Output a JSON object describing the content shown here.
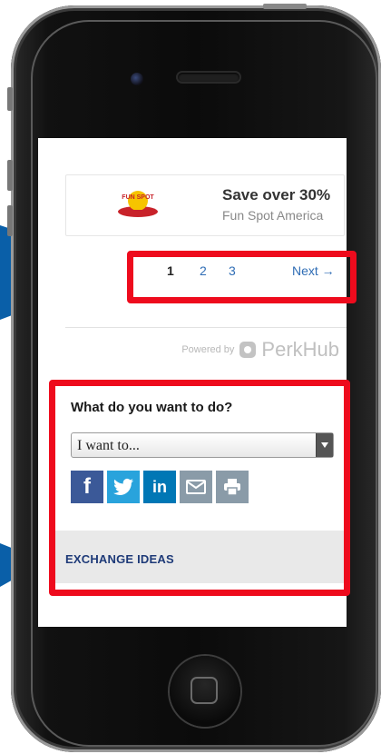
{
  "promo": {
    "title": "Save over 30%",
    "merchant": "Fun Spot America",
    "logo_text": "FUN SPOT"
  },
  "pagination": {
    "current": "1",
    "pages": [
      "2",
      "3"
    ],
    "next_label": "Next →"
  },
  "branding": {
    "powered_by": "Powered by",
    "name": "PerkHub"
  },
  "actions": {
    "heading": "What do you want to do?",
    "select_value": "I want to...",
    "share_icons": [
      "facebook-icon",
      "twitter-icon",
      "linkedin-icon",
      "email-icon",
      "print-icon"
    ]
  },
  "exchange": {
    "label": "EXCHANGE IDEAS"
  },
  "colors": {
    "highlight": "#ee0b1d",
    "arrow": "#0a5fa8",
    "link": "#2f6db5",
    "facebook": "#3b5998",
    "twitter": "#29a3dc",
    "linkedin": "#0077b5"
  }
}
